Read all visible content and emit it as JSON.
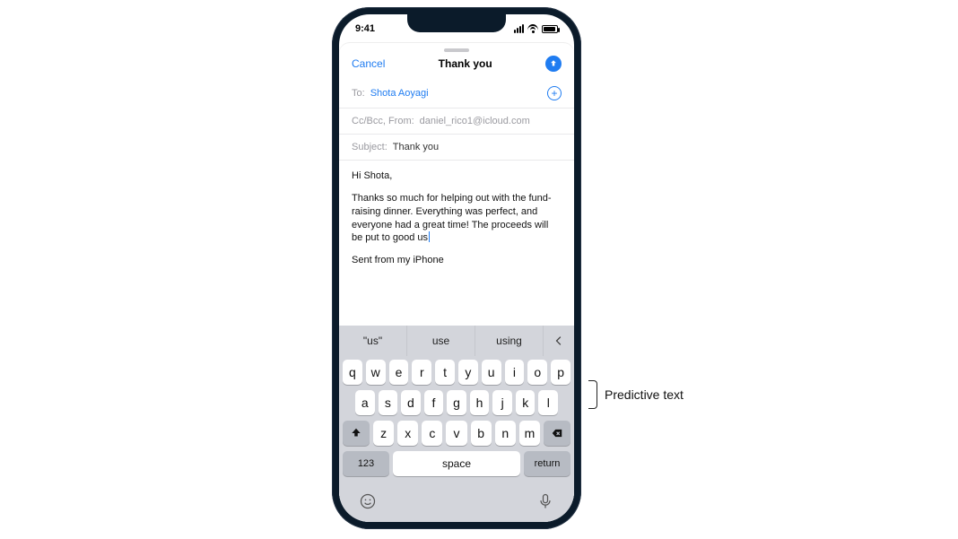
{
  "statusbar": {
    "time": "9:41"
  },
  "sheet": {
    "cancel": "Cancel",
    "title": "Thank you",
    "to_label": "To:",
    "to_name": "Shota Aoyagi",
    "ccbcc": "Cc/Bcc, From:",
    "from_addr": "daniel_rico1@icloud.com",
    "subject_label": "Subject:",
    "subject_value": "Thank you"
  },
  "body": {
    "greeting": "Hi Shota,",
    "p1": "Thanks so much for helping out with the fund-raising dinner. Everything was perfect, and everyone had a great time! The proceeds will be put to good us",
    "signature": "Sent from my iPhone"
  },
  "predictive": {
    "s1": "\"us\"",
    "s2": "use",
    "s3": "using"
  },
  "keyboard": {
    "row1": [
      "q",
      "w",
      "e",
      "r",
      "t",
      "y",
      "u",
      "i",
      "o",
      "p"
    ],
    "row2": [
      "a",
      "s",
      "d",
      "f",
      "g",
      "h",
      "j",
      "k",
      "l"
    ],
    "row3": [
      "z",
      "x",
      "c",
      "v",
      "b",
      "n",
      "m"
    ],
    "num": "123",
    "space": "space",
    "return": "return"
  },
  "callout": {
    "label": "Predictive text"
  }
}
